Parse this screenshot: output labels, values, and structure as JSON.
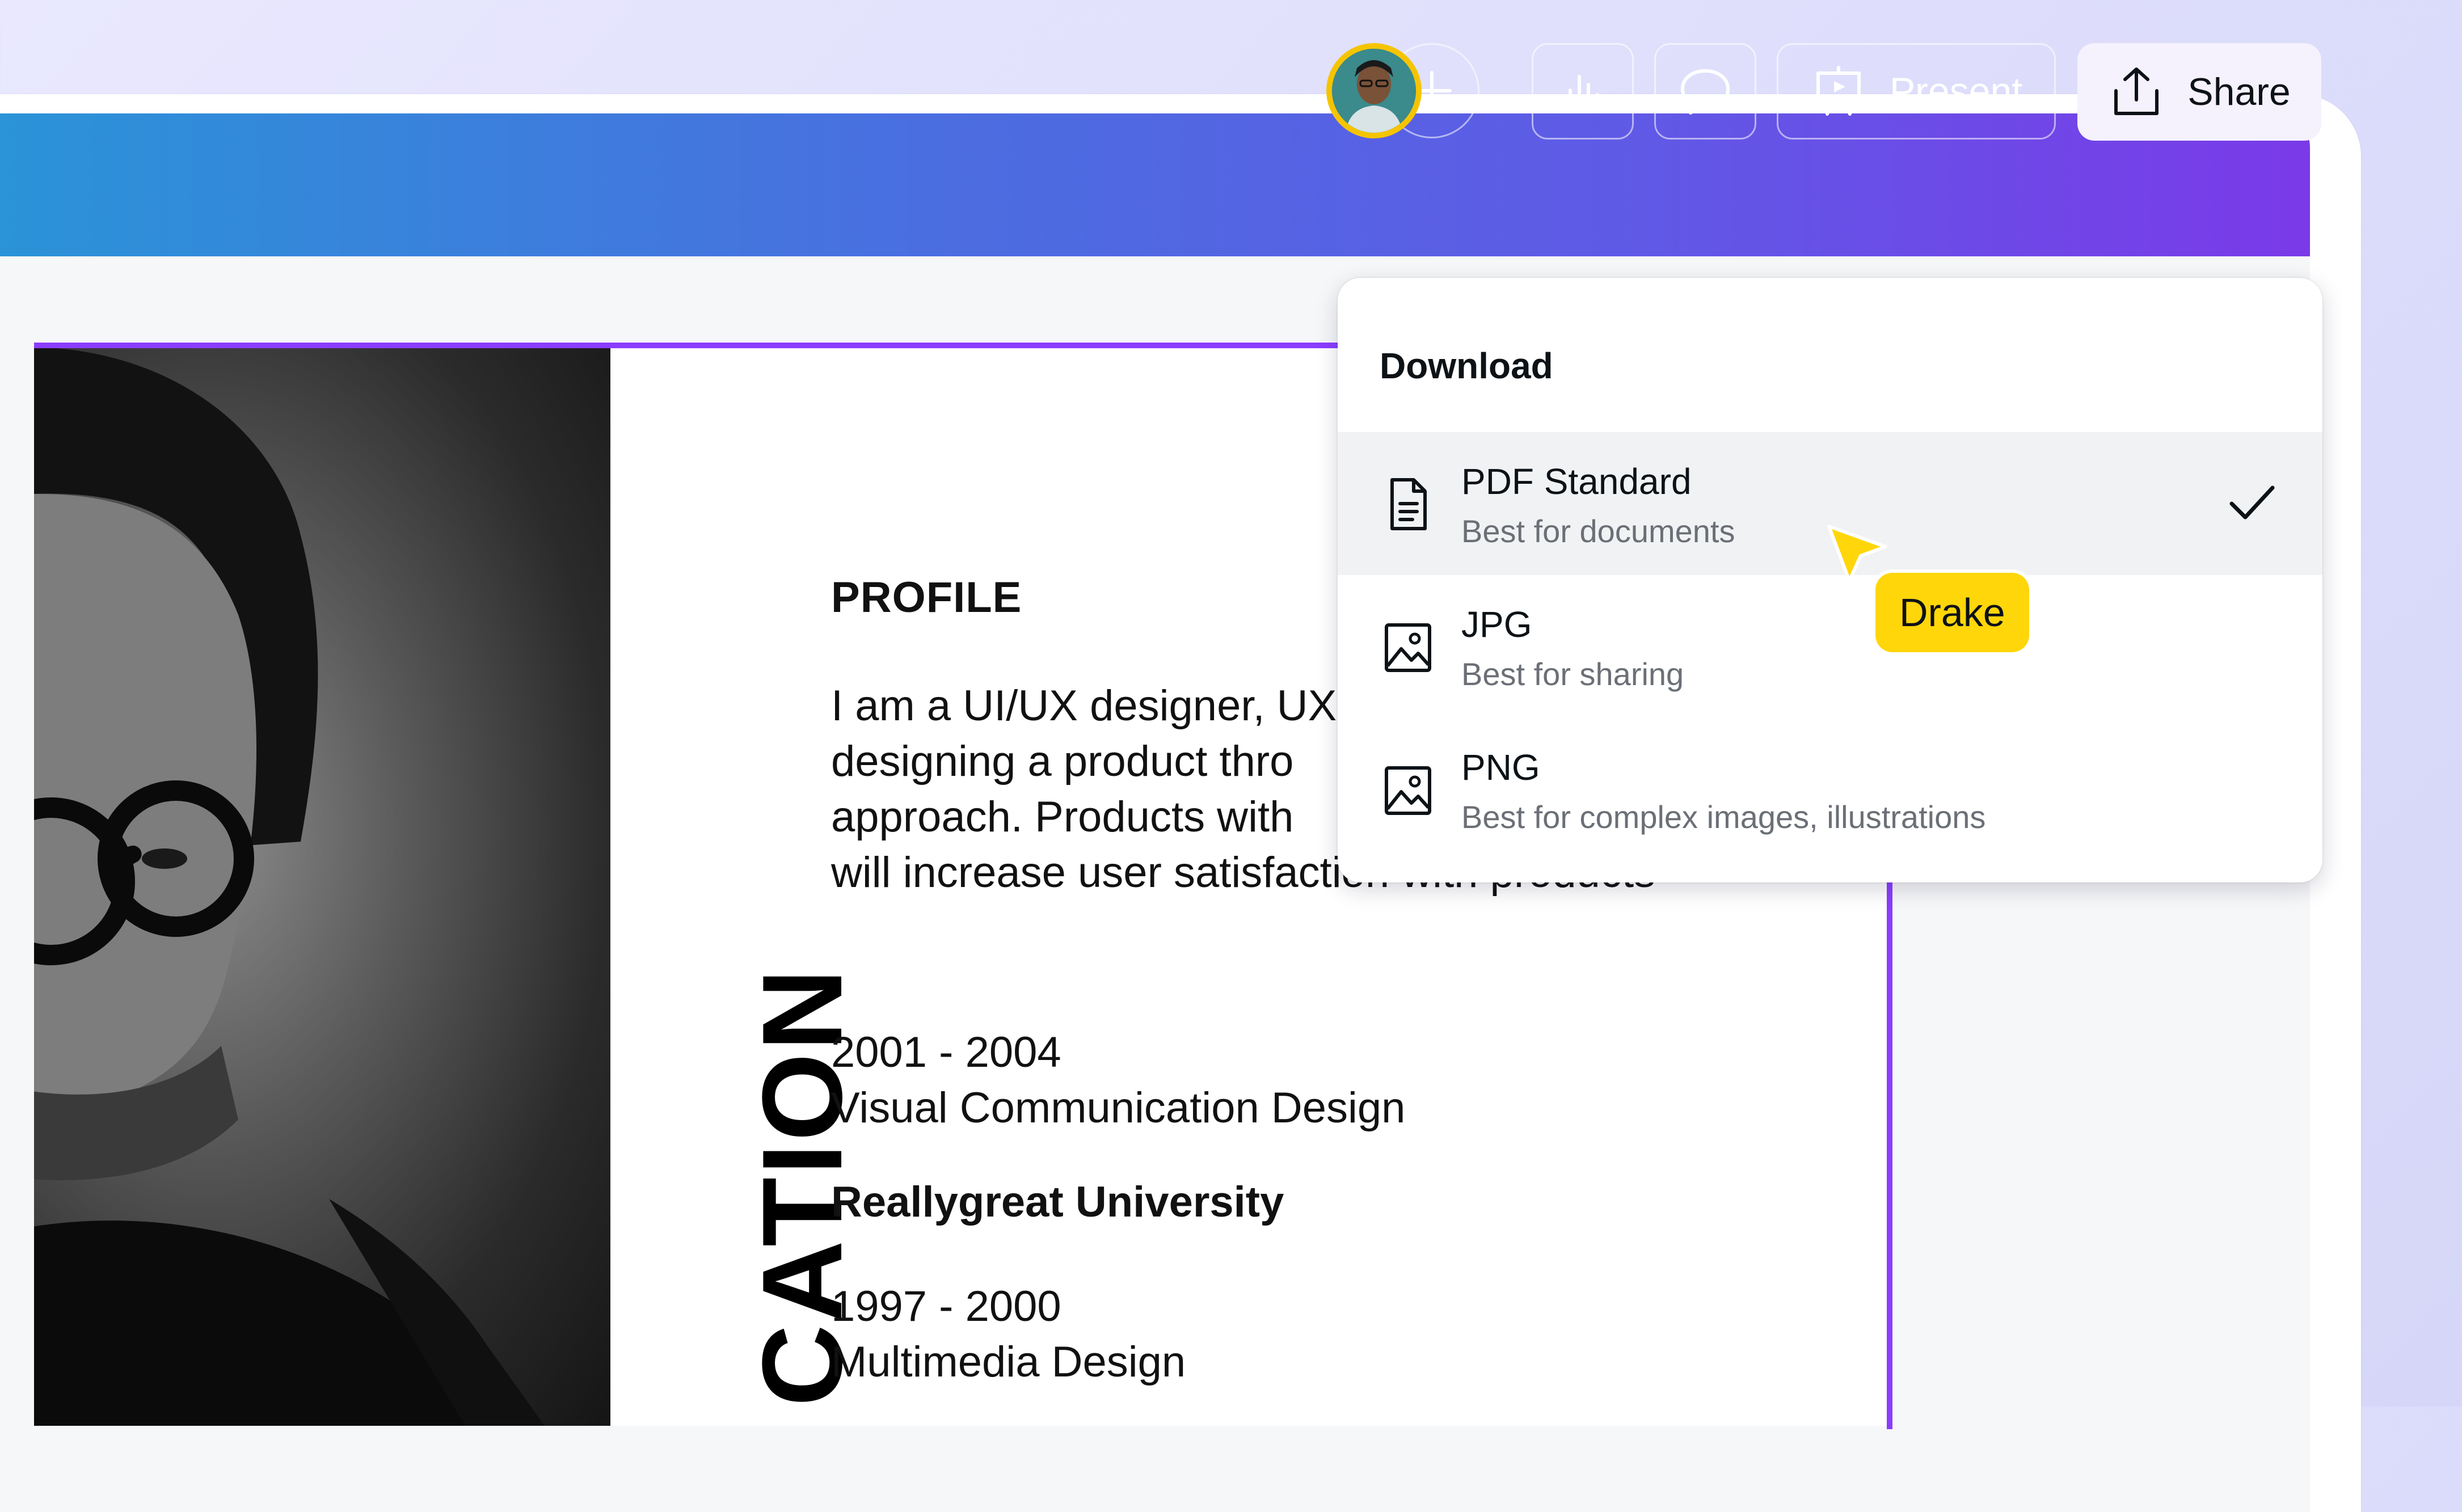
{
  "header": {
    "present_label": "Present",
    "share_label": "Share"
  },
  "download_menu": {
    "title": "Download",
    "items": [
      {
        "label": "PDF Standard",
        "description": "Best for documents",
        "icon": "file-text-icon",
        "selected": true
      },
      {
        "label": "JPG",
        "description": "Best for sharing",
        "icon": "image-icon",
        "selected": false
      },
      {
        "label": "PNG",
        "description": "Best for complex images, illustrations",
        "icon": "image-icon",
        "selected": false
      }
    ]
  },
  "collaborator": {
    "name": "Drake",
    "color": "#ffd60a"
  },
  "document": {
    "profile_heading": "PROFILE",
    "profile_lines": [
      "I am a UI/UX designer, UX",
      "designing a product thro",
      "approach. Products with",
      "will increase user satisfaction with products"
    ],
    "section_title": "CATION",
    "education": [
      {
        "years": "2001 - 2004",
        "program": "Visual Communication Design"
      },
      {
        "school": "Reallygreat University"
      },
      {
        "years": "1997 - 2000",
        "program": "Multimedia Design"
      }
    ]
  },
  "colors": {
    "accent": "#8b3dff",
    "header_start": "#2b93d8",
    "header_end": "#7a3ae8",
    "avatar_ring": "#f5c400"
  }
}
